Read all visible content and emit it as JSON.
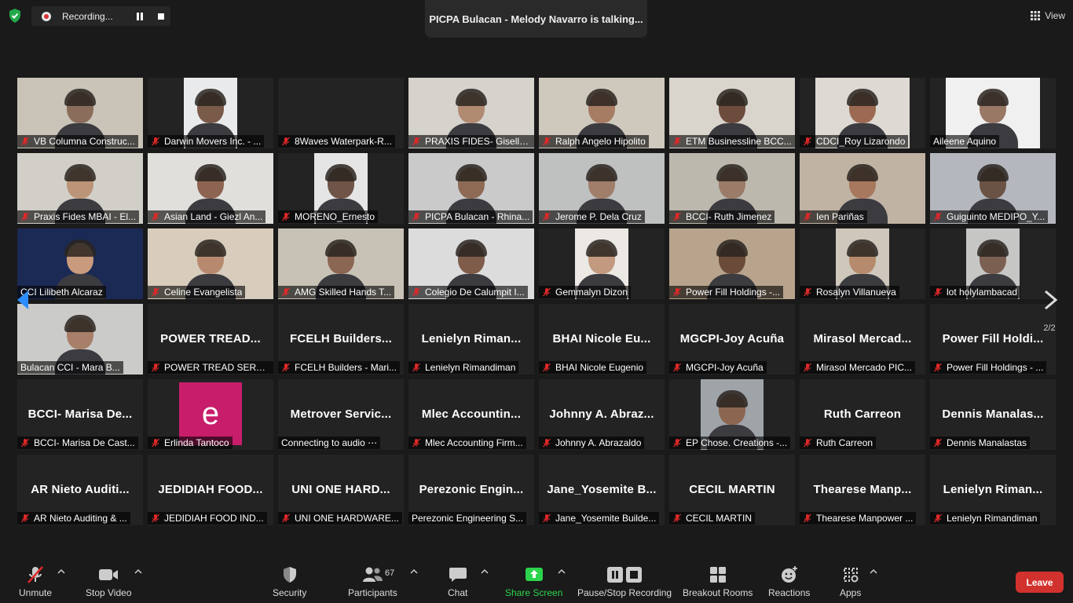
{
  "top": {
    "recording_label": "Recording...",
    "talking_banner": "PICPA Bulacan - Melody Navarro is talking...",
    "view_label": "View"
  },
  "pager": {
    "left": "2/2",
    "right": "2/2"
  },
  "colors": {
    "mic_muted": "#e02828",
    "share_green": "#2bd44c",
    "leave_red": "#d2322d",
    "avatar_magenta": "#c81d6b"
  },
  "tiles": [
    {
      "name": "VB Columna Construc...",
      "video": true,
      "bg": "#c9c3b8",
      "face": "#8a6d5a",
      "muted": true
    },
    {
      "name": "Darwin Movers Inc. - ...",
      "video": true,
      "bg": "#e9eaec",
      "face": "#7a5a48",
      "muted": true
    },
    {
      "name": "8Waves Waterpark-R...",
      "video": false,
      "big": "",
      "muted": true
    },
    {
      "name": "PRAXIS FIDES- Giselle...",
      "video": true,
      "bg": "#d6d2cc",
      "face": "#b18a72",
      "muted": true
    },
    {
      "name": "Ralph Angelo Hipolito",
      "video": true,
      "bg": "#cfc9bd",
      "face": "#a67c63",
      "muted": true
    },
    {
      "name": "ETM Businessline BCC...",
      "video": true,
      "bg": "#d9d4cc",
      "face": "#6e4c3d",
      "muted": true
    },
    {
      "name": "CDCI_Roy Lizarondo",
      "video": true,
      "bg": "#dedad3",
      "face": "#9c6a52",
      "muted": true
    },
    {
      "name": "Aileene Aquino",
      "video": true,
      "bg": "#f0f0f0",
      "face": "#9a7866",
      "muted": false
    },
    {
      "name": "Praxis Fides MBAI - El...",
      "video": true,
      "bg": "#d2cfc8",
      "face": "#bc9478",
      "muted": true
    },
    {
      "name": "Asian Land - Giezl An...",
      "video": true,
      "bg": "#e1dfdb",
      "face": "#8d6451",
      "muted": true
    },
    {
      "name": "MORENO_Ernesto",
      "video": true,
      "bg": "#e5e5e5",
      "face": "#6f5447",
      "muted": true
    },
    {
      "name": "PICPA Bulacan - Rhina...",
      "video": true,
      "bg": "#cacaca",
      "face": "#8e6a55",
      "muted": true
    },
    {
      "name": "Jerome P. Dela Cruz",
      "video": true,
      "bg": "#bfc0c0",
      "face": "#a07e6a",
      "muted": true
    },
    {
      "name": "BCCI- Ruth Jimenez",
      "video": true,
      "bg": "#bdb8ae",
      "face": "#9a7c68",
      "muted": true
    },
    {
      "name": "Ien Pariñas",
      "video": true,
      "bg": "#c0b3a3",
      "face": "#a7785e",
      "muted": true
    },
    {
      "name": "Guiguinto MEDIPO_Y...",
      "video": true,
      "bg": "#b4b7bd",
      "face": "#6a5244",
      "muted": true
    },
    {
      "name": "CCI Lilibeth Alcaraz",
      "video": true,
      "bg": "#1b2a55",
      "face": "#c99a7c",
      "muted": false
    },
    {
      "name": "Celine Evangelista",
      "video": true,
      "bg": "#d8ccbc",
      "face": "#b78a70",
      "muted": true
    },
    {
      "name": "AMG Skilled Hands T...",
      "video": true,
      "bg": "#c8c2b6",
      "face": "#8b6652",
      "muted": true
    },
    {
      "name": "Colegio De Calumpit I...",
      "video": true,
      "bg": "#dcdcdc",
      "face": "#7e5c49",
      "muted": true
    },
    {
      "name": "Gemmalyn Dizon",
      "video": true,
      "bg": "#ece8e3",
      "face": "#c29a80",
      "muted": true
    },
    {
      "name": "Power Fill Holdings -...",
      "video": true,
      "bg": "#b8a48c",
      "face": "#6a4a38",
      "muted": true
    },
    {
      "name": "Rosalyn Villanueva",
      "video": true,
      "bg": "#cfc7bb",
      "face": "#b68a6d",
      "muted": true
    },
    {
      "name": "lot holylambacad",
      "video": true,
      "bg": "#c6c6c4",
      "face": "#7b6051",
      "muted": true
    },
    {
      "name": "Bulacan CCI - Mara B...",
      "video": true,
      "bg": "#cbcbc9",
      "face": "#a87f69",
      "muted": false
    },
    {
      "name": "POWER TREAD SERVI...",
      "video": false,
      "big": "POWER TREAD...",
      "muted": true
    },
    {
      "name": "FCELH Builders - Mari...",
      "video": false,
      "big": "FCELH Builders...",
      "muted": true
    },
    {
      "name": "Lenielyn Rimandiman",
      "video": false,
      "big": "Lenielyn Riman...",
      "muted": true
    },
    {
      "name": "BHAI Nicole Eugenio",
      "video": false,
      "big": "BHAI Nicole Eu...",
      "muted": true
    },
    {
      "name": "MGCPI-Joy Acuña",
      "video": false,
      "big": "MGCPI-Joy Acuña",
      "muted": true
    },
    {
      "name": "Mirasol Mercado PIC...",
      "video": false,
      "big": "Mirasol Mercad...",
      "muted": true
    },
    {
      "name": "Power Fill Holdings - ...",
      "video": false,
      "big": "Power Fill Holdi...",
      "muted": true
    },
    {
      "name": "BCCI- Marisa De Cast...",
      "video": false,
      "big": "BCCI- Marisa De...",
      "muted": true
    },
    {
      "name": "Erlinda Tantoco",
      "video": false,
      "avatar": "e",
      "muted": true
    },
    {
      "name": "Connecting to audio ⋯",
      "video": false,
      "big": "Metrover Servic...",
      "muted": false,
      "nomic": true
    },
    {
      "name": "Mlec Accounting Firm...",
      "video": false,
      "big": "Mlec Accountin...",
      "muted": true
    },
    {
      "name": "Johnny A. Abrazaldo",
      "video": false,
      "big": "Johnny A. Abraz...",
      "muted": true
    },
    {
      "name": "EP Chose. Creations -...",
      "video": true,
      "bg": "#9fa4a8",
      "face": "#8d6652",
      "muted": true
    },
    {
      "name": "Ruth Carreon",
      "video": false,
      "big": "Ruth Carreon",
      "muted": true
    },
    {
      "name": "Dennis Manalastas",
      "video": false,
      "big": "Dennis Manalas...",
      "muted": true
    },
    {
      "name": "AR Nieto Auditing & ...",
      "video": false,
      "big": "AR Nieto Auditi...",
      "muted": true
    },
    {
      "name": "JEDIDIAH FOOD IND...",
      "video": false,
      "big": "JEDIDIAH FOOD...",
      "muted": true
    },
    {
      "name": "UNI ONE HARDWARE...",
      "video": false,
      "big": "UNI ONE HARD...",
      "muted": true
    },
    {
      "name": "Perezonic Engineering S...",
      "video": false,
      "big": "Perezonic Engin...",
      "muted": false
    },
    {
      "name": "Jane_Yosemite Builde...",
      "video": false,
      "big": "Jane_Yosemite B...",
      "muted": true
    },
    {
      "name": "CECIL MARTIN",
      "video": false,
      "big": "CECIL MARTIN",
      "muted": true
    },
    {
      "name": "Thearese Manpower ...",
      "video": false,
      "big": "Thearese Manp...",
      "muted": true
    },
    {
      "name": "Lenielyn Rimandiman",
      "video": false,
      "big": "Lenielyn Riman...",
      "muted": true
    }
  ],
  "toolbar": {
    "unmute": "Unmute",
    "stop_video": "Stop Video",
    "security": "Security",
    "participants": "Participants",
    "participants_count": "67",
    "chat": "Chat",
    "share_screen": "Share Screen",
    "pause_stop_recording": "Pause/Stop Recording",
    "breakout_rooms": "Breakout Rooms",
    "reactions": "Reactions",
    "apps": "Apps",
    "leave": "Leave"
  }
}
